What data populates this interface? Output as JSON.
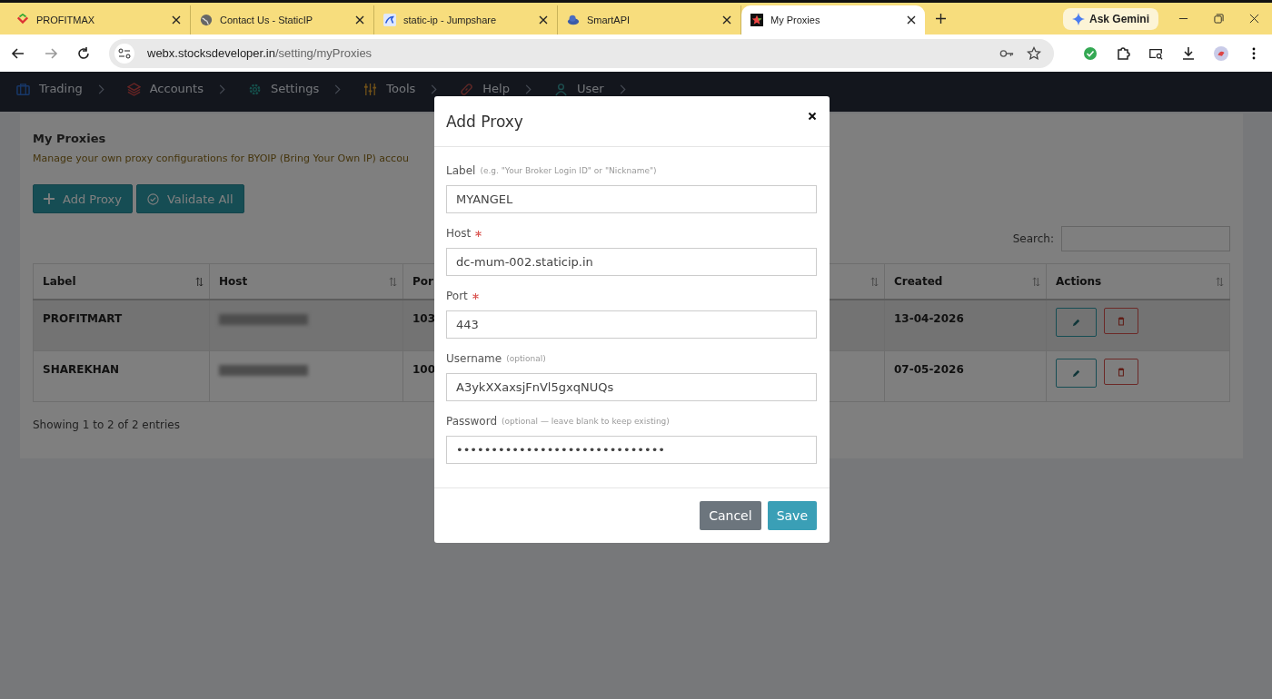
{
  "browser": {
    "tabs": [
      {
        "title": "PROFITMAX",
        "kind": "chevron",
        "selected": false
      },
      {
        "title": "Contact Us - StaticIP",
        "kind": "globe",
        "selected": false
      },
      {
        "title": "static-ip - Jumpshare",
        "kind": "kangaroo",
        "selected": false
      },
      {
        "title": "SmartAPI",
        "kind": "cloud",
        "selected": false
      },
      {
        "title": "My Proxies",
        "kind": "star",
        "selected": true
      }
    ],
    "gemini_button": "Ask Gemini",
    "url": {
      "host": "webx.stocksdeveloper.in",
      "path": "/setting/myProxies"
    }
  },
  "nav": {
    "items": [
      {
        "label": "Trading",
        "kind": "briefcase"
      },
      {
        "label": "Accounts",
        "kind": "layers"
      },
      {
        "label": "Settings",
        "kind": "gear"
      },
      {
        "label": "Tools",
        "kind": "sliders"
      },
      {
        "label": "Help",
        "kind": "link"
      },
      {
        "label": "User",
        "kind": "user"
      }
    ]
  },
  "page": {
    "title": "My Proxies",
    "description": "Manage your own proxy configurations for BYOIP (Bring Your Own IP) accou",
    "buttons": [
      {
        "label": "Add Proxy",
        "kind": "plus"
      },
      {
        "label": "Validate All",
        "kind": "check"
      }
    ],
    "search": {
      "label": "Search:"
    },
    "table": {
      "columns": [
        "Label",
        "Host",
        "Por",
        "Created",
        "Actions"
      ],
      "rows": [
        {
          "label": "PROFITMART",
          "port": "103",
          "created": "13-04-2026",
          "highlighted": true
        },
        {
          "label": "SHAREKHAN",
          "port": "100",
          "created": "07-05-2026",
          "highlighted": false
        }
      ]
    },
    "footer": "Showing 1 to 2 of 2 entries"
  },
  "dialog": {
    "title": "Add Proxy",
    "fields": [
      {
        "label": "Label",
        "hint": "(e.g. \"Your Broker Login ID\" or \"Nickname\")",
        "required": false,
        "value": "MYANGEL"
      },
      {
        "label": "Host",
        "required": true,
        "value": "dc-mum-002.staticip.in"
      },
      {
        "label": "Port",
        "required": true,
        "value": "443"
      },
      {
        "label": "Username",
        "hint": "(optional)",
        "required": false,
        "value": "A3ykXXaxsjFnVl5gxqNUQs"
      },
      {
        "label": "Password",
        "hint": "(optional — leave blank to keep existing)",
        "required": false,
        "value": "••••••••••••••••••••••••••••••"
      }
    ],
    "buttons": [
      {
        "label": "Cancel",
        "kind": "secondary"
      },
      {
        "label": "Save",
        "kind": "primary"
      }
    ]
  }
}
